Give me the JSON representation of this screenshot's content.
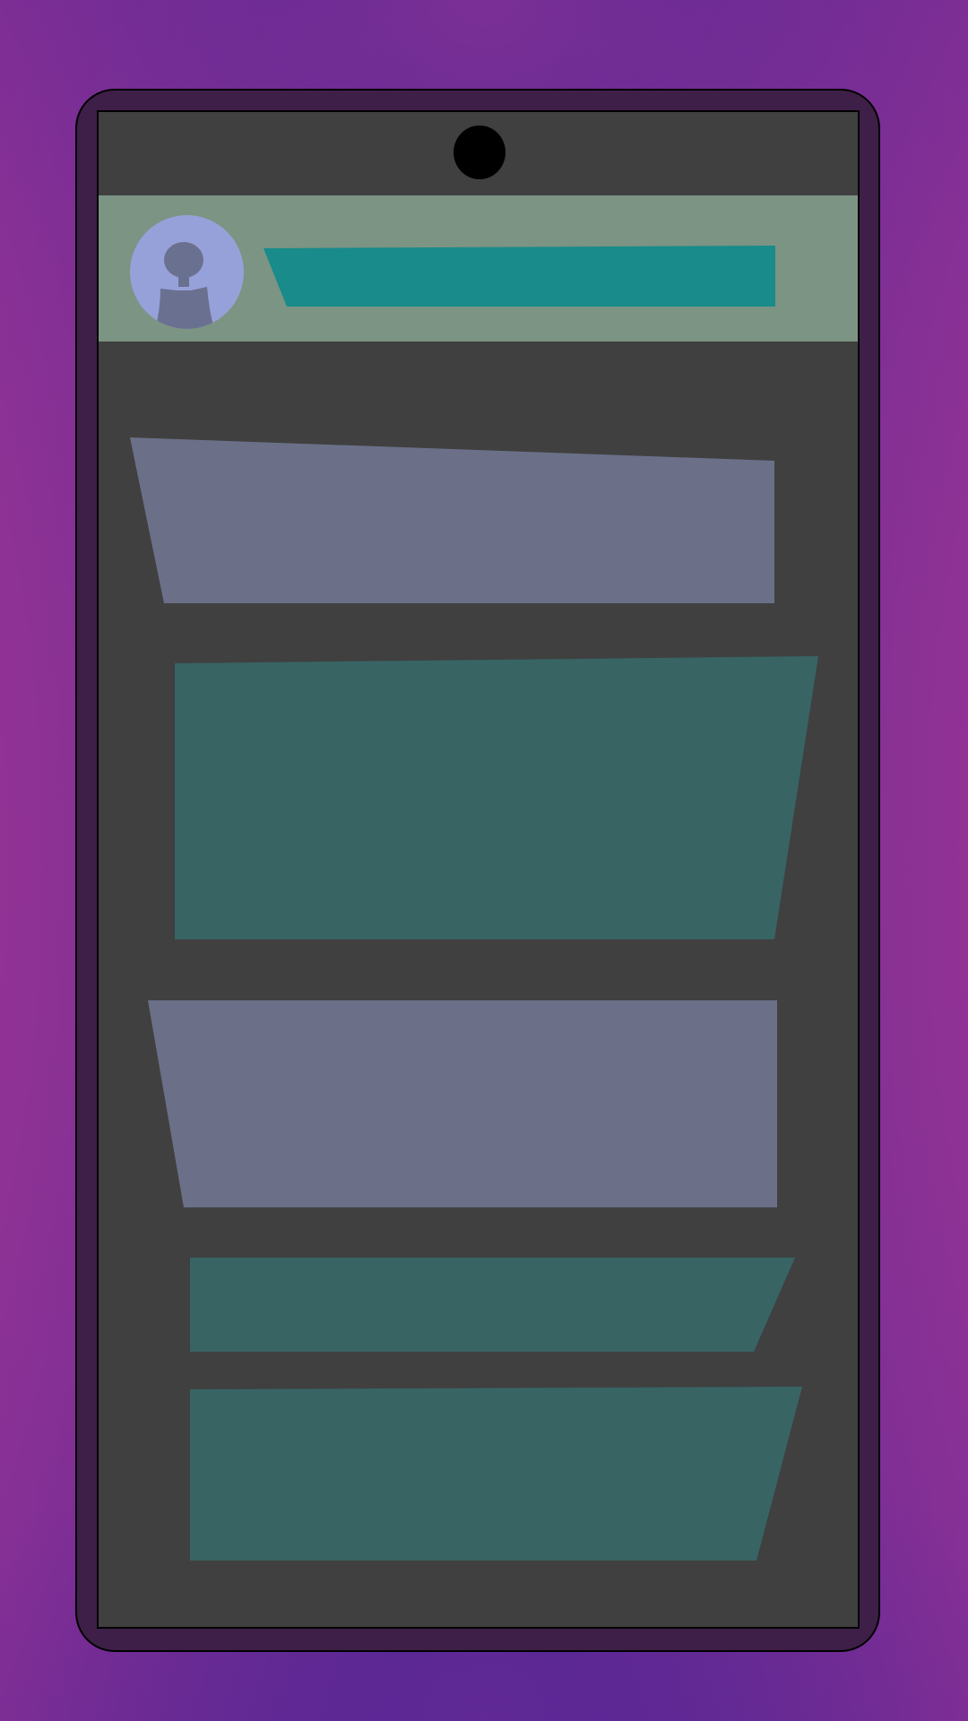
{
  "theme": {
    "frame": "#3e1f47",
    "screen": "#404040",
    "header": "#7c9483",
    "avatar_bg": "#97a1d9",
    "avatar_fg": "#6a7090",
    "title_bar": "#188b8a",
    "incoming_bubble": "#6b7088",
    "outgoing_bubble": "#386464"
  },
  "header": {
    "avatar_icon": "person-silhouette-icon",
    "title": ""
  },
  "messages": [
    {
      "side": "incoming",
      "text": ""
    },
    {
      "side": "outgoing",
      "text": ""
    },
    {
      "side": "incoming",
      "text": ""
    },
    {
      "side": "outgoing",
      "text": ""
    },
    {
      "side": "outgoing",
      "text": ""
    }
  ]
}
